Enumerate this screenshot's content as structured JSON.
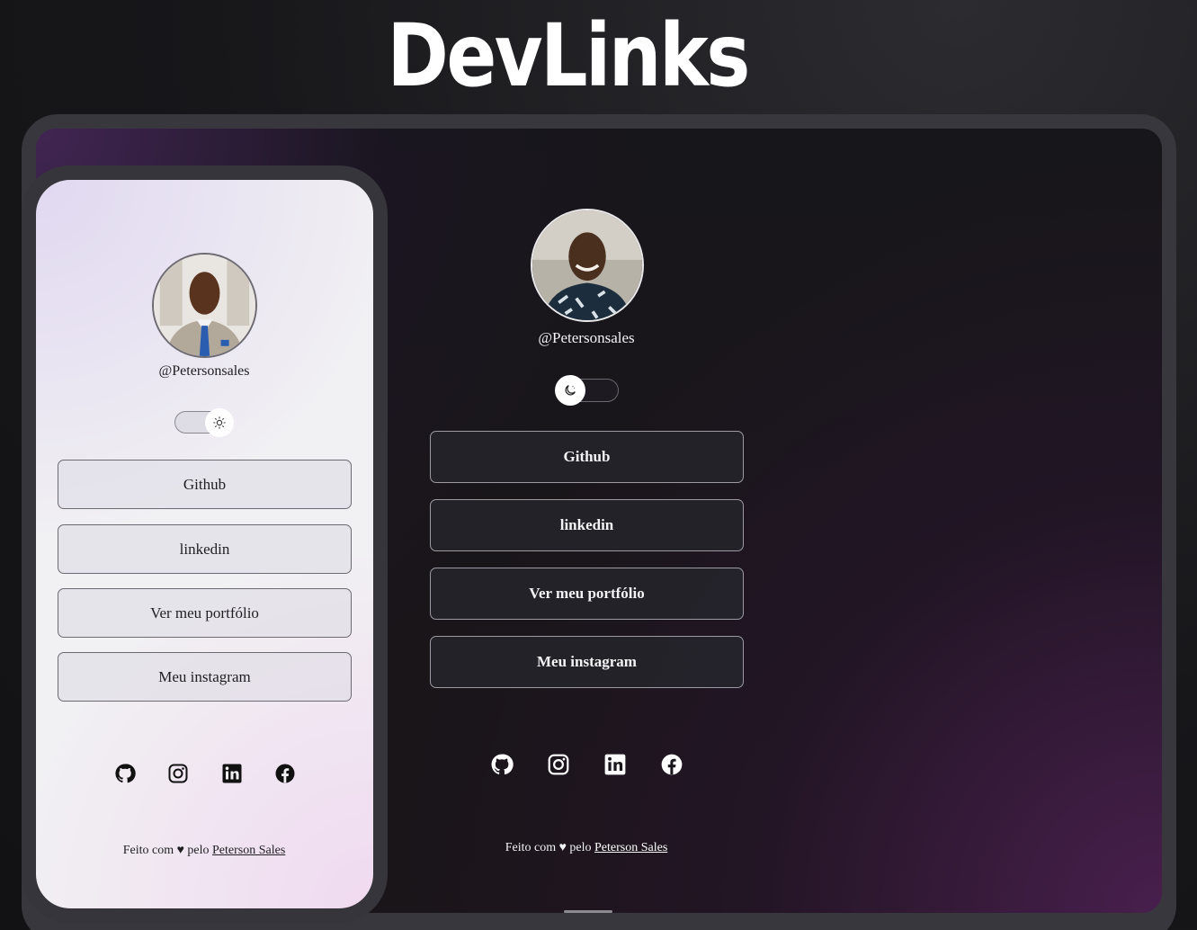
{
  "app": {
    "title": "DevLinks"
  },
  "colors": {
    "dark_bg": "#18171b",
    "accent_purple": "#6e2878",
    "light_bg": "#f1f0f3",
    "frame": "#38373e"
  },
  "mobile": {
    "theme": "light",
    "handle": "@Petersonsales",
    "toggle_icon": "sun-icon",
    "links": [
      {
        "label": "Github"
      },
      {
        "label": "linkedin"
      },
      {
        "label": "Ver meu portfólio"
      },
      {
        "label": "Meu instagram"
      }
    ],
    "socials": [
      "github-icon",
      "instagram-icon",
      "linkedin-icon",
      "facebook-icon"
    ],
    "footer": {
      "prefix": "Feito com ♥ pelo",
      "author": "Peterson Sales"
    }
  },
  "desktop": {
    "theme": "dark",
    "handle": "@Petersonsales",
    "toggle_icon": "moon-icon",
    "links": [
      {
        "label": "Github"
      },
      {
        "label": "linkedin"
      },
      {
        "label": "Ver meu portfólio"
      },
      {
        "label": "Meu instagram"
      }
    ],
    "socials": [
      "github-icon",
      "instagram-icon",
      "linkedin-icon",
      "facebook-icon"
    ],
    "footer": {
      "prefix": "Feito com ♥ pelo",
      "author": "Peterson Sales"
    }
  }
}
